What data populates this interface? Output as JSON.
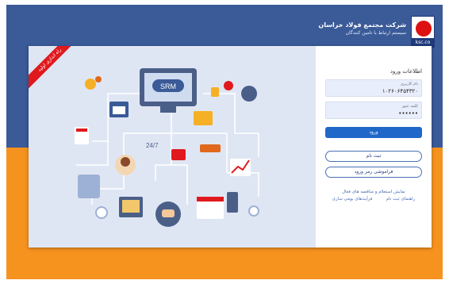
{
  "header": {
    "company_name": "شرکت مجتمع فولاد خراسان",
    "system_name": "سیستم ارتباط با تامین کنندگان",
    "logo_text": "ksc.co"
  },
  "illustration": {
    "ribbon_text": "راه اندازی اولیه",
    "srm_label": "SRM",
    "hours_label": "24/7"
  },
  "login": {
    "title": "اطلاعات ورود",
    "username_label": "نام کاربری",
    "username_value": "۱۰۲۶۰۶۴۵۴۳۲۰",
    "password_label": "کلمه عبور",
    "password_value": "••••••",
    "login_button": "ورود",
    "register_button": "ثبت نام",
    "forgot_button": "فراموشی رمز ورود",
    "link_active_jobs": "نمایش استعلام و مناقصه های فعال",
    "link_register_guide": "راهنمای ثبت نام",
    "link_process_video": "فرآیندهای بومی سازی"
  },
  "colors": {
    "blue_band": "#3a5a98",
    "orange_band": "#f6921e",
    "primary_button": "#1f68c9",
    "ribbon": "#e0191d"
  }
}
